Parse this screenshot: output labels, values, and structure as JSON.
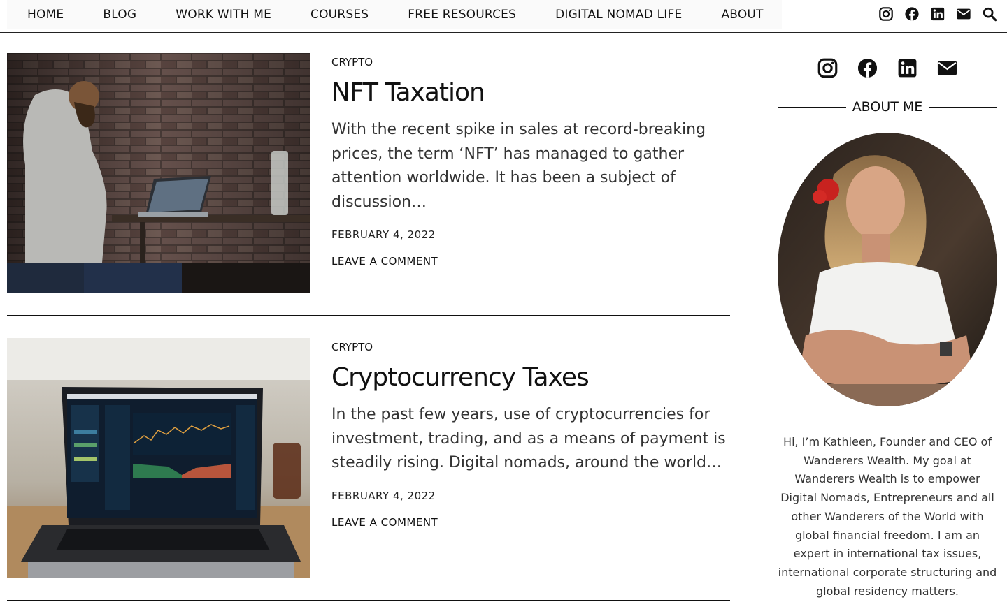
{
  "nav": {
    "items": [
      "HOME",
      "BLOG",
      "WORK WITH ME",
      "COURSES",
      "FREE RESOURCES",
      "DIGITAL NOMAD LIFE",
      "ABOUT"
    ],
    "icons": [
      "instagram-icon",
      "facebook-icon",
      "linkedin-icon",
      "email-icon",
      "search-icon"
    ]
  },
  "posts": [
    {
      "category": "CRYPTO",
      "title": "NFT Taxation",
      "excerpt": "With the recent spike in sales at record-breaking prices, the term ‘NFT’ has managed to gather attention worldwide. It has been a subject of discussion…",
      "date": "FEBRUARY 4, 2022",
      "comment_link": "LEAVE A COMMENT",
      "image": "man-working-on-laptop-photo"
    },
    {
      "category": "CRYPTO",
      "title": "Cryptocurrency Taxes",
      "excerpt": "In the past few years, use of cryptocurrencies for investment, trading, and as a means of payment is steadily rising. Digital nomads, around the world…",
      "date": "FEBRUARY 4, 2022",
      "comment_link": "LEAVE A COMMENT",
      "image": "laptop-trading-chart-photo"
    }
  ],
  "sidebar": {
    "icons": [
      "instagram-icon",
      "facebook-icon",
      "linkedin-icon",
      "email-icon"
    ],
    "about_heading": "ABOUT ME",
    "bio": "Hi, I’m Kathleen, Founder and CEO of Wanderers Wealth. My goal at Wanderers Wealth is to empower Digital Nomads, Entrepreneurs and all other Wanderers of the World with global financial freedom. I am an expert in international tax issues, international corporate structuring and global residency matters."
  }
}
